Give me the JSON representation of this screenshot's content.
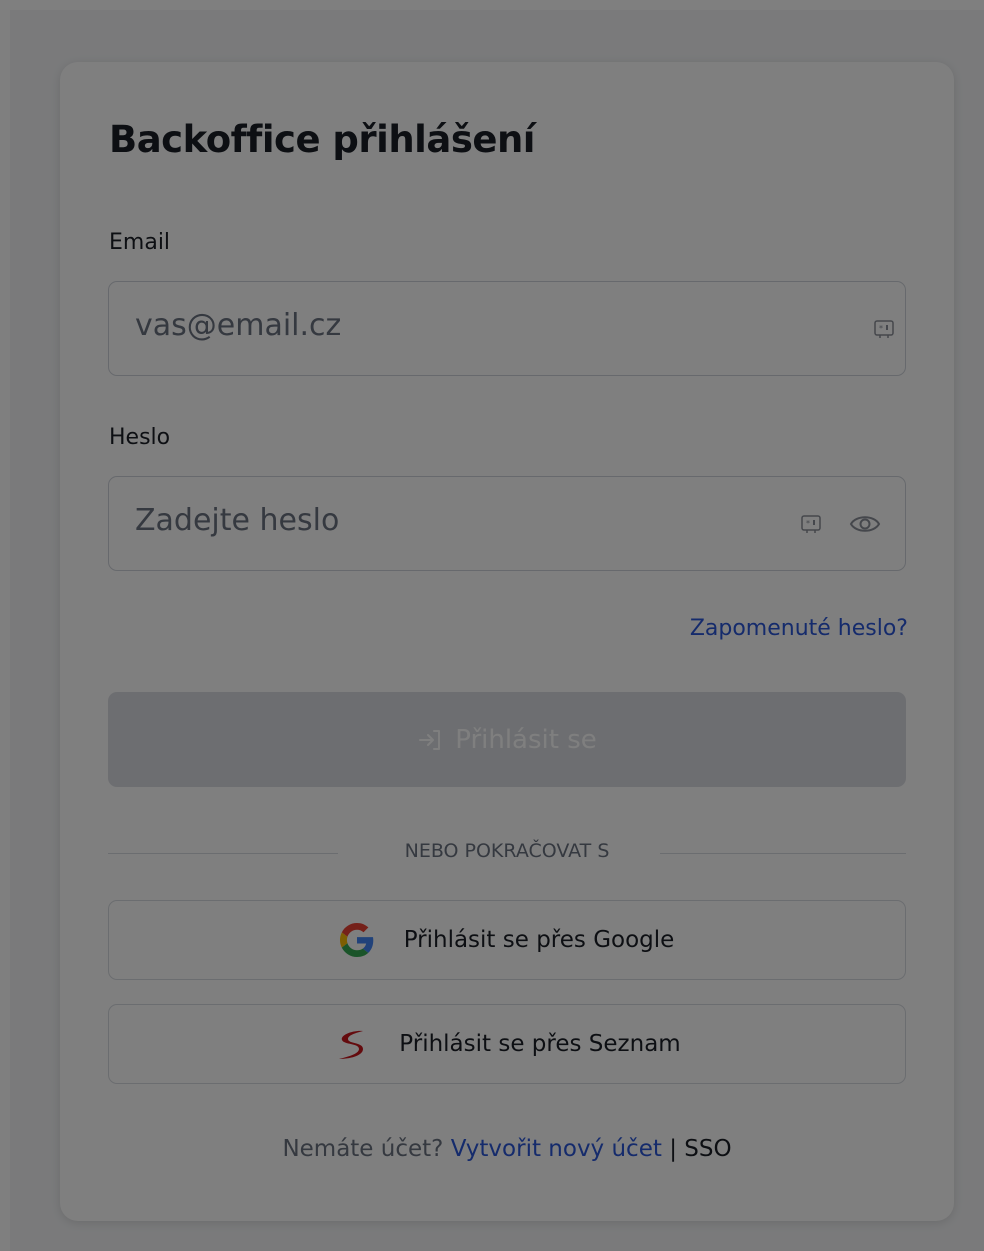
{
  "login": {
    "title": "Backoffice přihlášení",
    "email": {
      "label": "Email",
      "placeholder": "vas@email.cz"
    },
    "password": {
      "label": "Heslo",
      "placeholder": "Zadejte heslo"
    },
    "forgot_link": "Zapomenuté heslo?",
    "submit_label": "Přihlásit se",
    "divider_text": "NEBO POKRAČOVAT S",
    "google_label": "Přihlásit se přes Google",
    "seznam_label": "Přihlásit se přes Seznam",
    "footer": {
      "prompt": "Nemáte účet?",
      "create_link": "Vytvořit nový účet",
      "separator": "|",
      "sso_link": "SSO"
    }
  },
  "icons": {
    "autofill": "contact-card-icon",
    "password_toggle": "eye-icon",
    "submit": "login-arrow-icon",
    "google": "google-logo-icon",
    "seznam": "seznam-logo-icon"
  },
  "colors": {
    "link": "#2b57d8",
    "dimmed_overlay": "rgba(0,0,0,0.5)",
    "disabled_button": "#dadde2",
    "seznam_red": "#c8161d"
  }
}
